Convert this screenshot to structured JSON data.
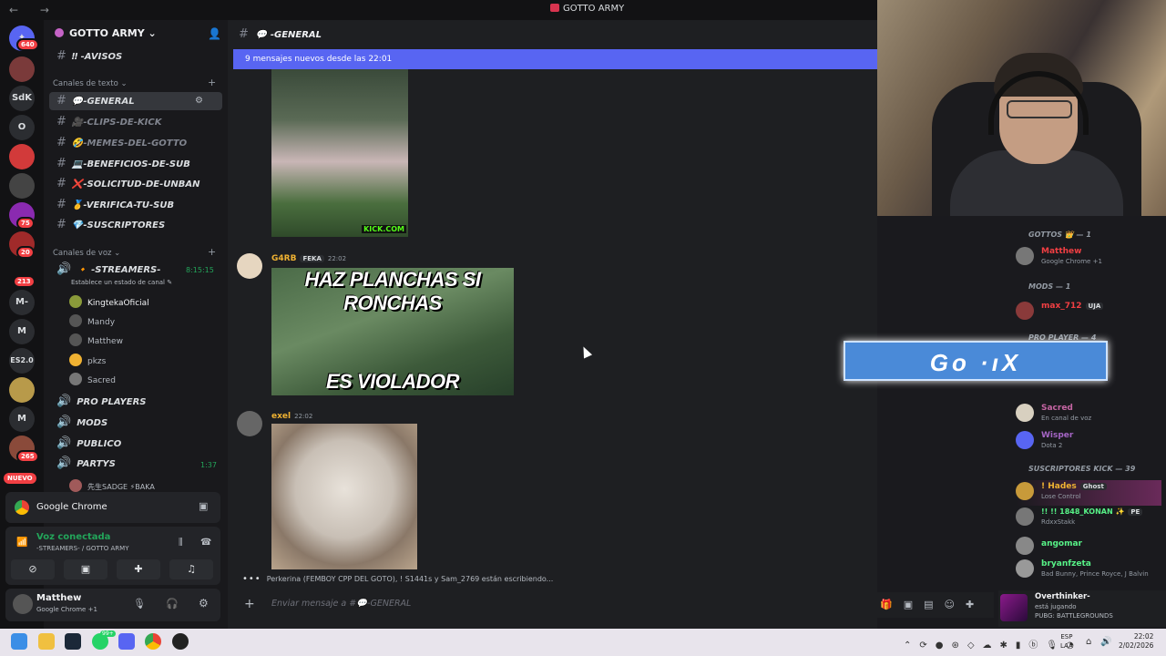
{
  "window": {
    "title": "GOTTO ARMY",
    "nav": "← →"
  },
  "servers": [
    {
      "label": "",
      "badge": "640"
    },
    {
      "label": "",
      "badge": ""
    },
    {
      "label": "SdK",
      "badge": ""
    },
    {
      "label": "O",
      "badge": ""
    },
    {
      "label": "",
      "badge": ""
    },
    {
      "label": "",
      "badge": ""
    },
    {
      "label": "",
      "badge": "75"
    },
    {
      "label": "",
      "badge": "20"
    },
    {
      "label": "",
      "badge": "213"
    },
    {
      "label": "M-",
      "badge": ""
    },
    {
      "label": "M",
      "badge": ""
    },
    {
      "label": "ES2.0",
      "badge": ""
    },
    {
      "label": "",
      "badge": ""
    },
    {
      "label": "M",
      "badge": ""
    },
    {
      "label": "",
      "badge": "265"
    }
  ],
  "new_badge": "NUEVO",
  "sidebar": {
    "guild_name": "GOTTO ARMY ⌄",
    "top_channel": "‼ -AVISOS",
    "text_category": "Canales de texto ⌄",
    "text_channels": [
      {
        "name": "-GENERAL",
        "emoji": "💬",
        "selected": true,
        "muted": false
      },
      {
        "name": "-CLIPS-DE-KICK",
        "emoji": "🎥",
        "selected": false,
        "muted": true
      },
      {
        "name": "-MEMES-DEL-GOTTO",
        "emoji": "🤣",
        "selected": false,
        "muted": true
      },
      {
        "name": "-BENEFICIOS-DE-SUB",
        "emoji": "💻",
        "selected": false,
        "muted": false
      },
      {
        "name": "-SOLICITUD-DE-UNBAN",
        "emoji": "❌",
        "selected": false,
        "muted": false
      },
      {
        "name": "-VERIFICA-TU-SUB",
        "emoji": "🥇",
        "selected": false,
        "muted": false
      },
      {
        "name": "-SUSCRIPTORES",
        "emoji": "💎",
        "selected": false,
        "muted": false
      }
    ],
    "voice_category": "Canales de voz ⌄",
    "voice_channel": {
      "name": "🔸 -STREAMERS-",
      "time": "8:15:15",
      "status": "Establece un estado de canal ✎"
    },
    "voice_users": [
      "KingtekaOficial",
      "Mandy",
      "Matthew",
      "pkzs",
      "Sacred"
    ],
    "other_voice": [
      {
        "name": "PRO PLAYERS",
        "time": ""
      },
      {
        "name": "MODS",
        "time": ""
      },
      {
        "name": "PUBLICO",
        "time": ""
      },
      {
        "name": "PARTYS",
        "time": "1:37"
      }
    ],
    "partys_user": "先生SADGE ⚡BAKA",
    "chrome_label": "Google Chrome",
    "voice_connected": "Voz conectada",
    "voice_connected_sub": "-STREAMERS- / GOTTO ARMY",
    "user": {
      "name": "Matthew",
      "status": "Google Chrome +1"
    }
  },
  "main": {
    "channel_title": "💬 -GENERAL",
    "new_messages_bar": "9 mensajes nuevos desde las 22:01",
    "messages": [
      {
        "author": "G4RB",
        "tags": [
          "FEKA"
        ],
        "time": "22:02",
        "meme_top": "HAZ PLANCHAS SI RONCHAS",
        "meme_bottom": "ES VIOLADOR",
        "color": "#f0b232"
      },
      {
        "author": "exel",
        "tags": [],
        "time": "22:02",
        "color": "#f0b232"
      }
    ],
    "kick_watermark": "KICK.COM",
    "typing": "Perkerina (FEMBOY CPP DEL GOTO), ! S1441s y Sam_2769 están escribiendo...",
    "input_placeholder": "Enviar mensaje a #💬-GENERAL"
  },
  "overlay_text": "Go ·ıX",
  "members": {
    "categories": [
      {
        "title": "GOTTOS 👑 — 1"
      },
      {
        "title": "MODS — 1"
      },
      {
        "title": "PRO PLAYER — 4"
      },
      {
        "title": "SUSCRIPTORES KICK — 39"
      }
    ],
    "list": [
      {
        "name": "Matthew",
        "status": "Google Chrome +1",
        "color": "#f23f43"
      },
      {
        "name": "max_712",
        "status": "",
        "tag": "UJA",
        "color": "#f23f43"
      },
      {
        "name": "Sacred",
        "status": "En canal de voz",
        "color": "#c565a3"
      },
      {
        "name": "Wisper",
        "status": "Dota 2",
        "color": "#a565c5"
      },
      {
        "name": "! Hades",
        "status": "Lose Control",
        "tag": "Ghost",
        "color": "#f0b232"
      },
      {
        "name": "!! !! 1848_KONAN ✨",
        "status": "RdxxStakk",
        "tag": "PE",
        "color": "#57f287"
      },
      {
        "name": "angomar",
        "status": "",
        "color": "#57f287"
      },
      {
        "name": "bryanfzeta",
        "status": "Bad Bunny, Prince Royce, J Balvin",
        "color": "#57f287"
      }
    ],
    "activity": {
      "name": "Overthinker-",
      "line1": "está jugando",
      "line2": "PUBG: BATTLEGROUNDS"
    }
  },
  "taskbar": {
    "lang": "ESP\nLAA",
    "time": "22:02",
    "date": "2/02/2026",
    "whatsapp_badge": "99+"
  }
}
